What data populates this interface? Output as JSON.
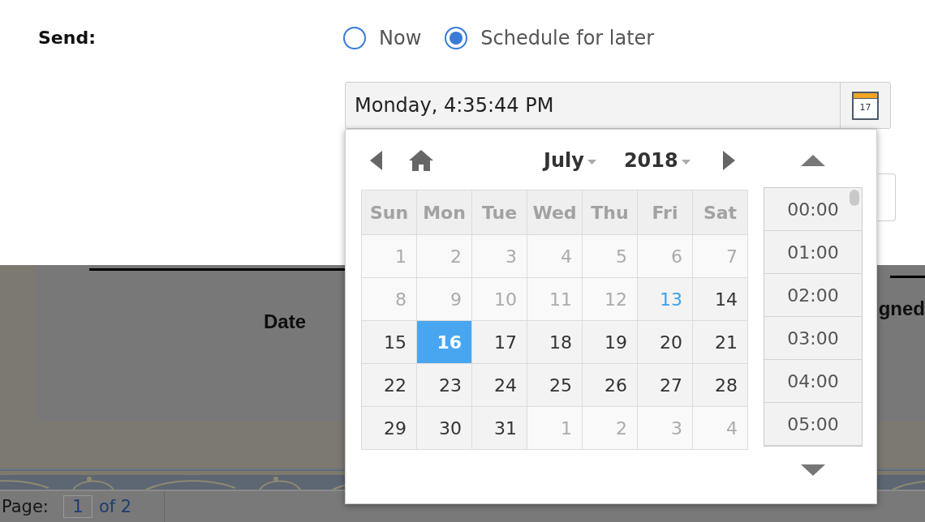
{
  "send": {
    "label": "Send:",
    "options": [
      {
        "label": "Now",
        "selected": false
      },
      {
        "label": "Schedule for later",
        "selected": true
      }
    ]
  },
  "schedule_field": {
    "value": "Monday, 4:35:44 PM",
    "calendar_icon_day": "17"
  },
  "date_picker": {
    "month": "July",
    "year": "2018",
    "weekdays": [
      "Sun",
      "Mon",
      "Tue",
      "Wed",
      "Thu",
      "Fri",
      "Sat"
    ],
    "weeks": [
      [
        {
          "day": "1",
          "muted": true,
          "today": false,
          "selected": false
        },
        {
          "day": "2",
          "muted": true,
          "today": false,
          "selected": false
        },
        {
          "day": "3",
          "muted": true,
          "today": false,
          "selected": false
        },
        {
          "day": "4",
          "muted": true,
          "today": false,
          "selected": false
        },
        {
          "day": "5",
          "muted": true,
          "today": false,
          "selected": false
        },
        {
          "day": "6",
          "muted": true,
          "today": false,
          "selected": false
        },
        {
          "day": "7",
          "muted": true,
          "today": false,
          "selected": false
        }
      ],
      [
        {
          "day": "8",
          "muted": true,
          "today": false,
          "selected": false
        },
        {
          "day": "9",
          "muted": true,
          "today": false,
          "selected": false
        },
        {
          "day": "10",
          "muted": true,
          "today": false,
          "selected": false
        },
        {
          "day": "11",
          "muted": true,
          "today": false,
          "selected": false
        },
        {
          "day": "12",
          "muted": true,
          "today": false,
          "selected": false
        },
        {
          "day": "13",
          "muted": false,
          "today": true,
          "selected": false
        },
        {
          "day": "14",
          "muted": false,
          "today": false,
          "selected": false
        }
      ],
      [
        {
          "day": "15",
          "muted": false,
          "today": false,
          "selected": false
        },
        {
          "day": "16",
          "muted": false,
          "today": false,
          "selected": true
        },
        {
          "day": "17",
          "muted": false,
          "today": false,
          "selected": false
        },
        {
          "day": "18",
          "muted": false,
          "today": false,
          "selected": false
        },
        {
          "day": "19",
          "muted": false,
          "today": false,
          "selected": false
        },
        {
          "day": "20",
          "muted": false,
          "today": false,
          "selected": false
        },
        {
          "day": "21",
          "muted": false,
          "today": false,
          "selected": false
        }
      ],
      [
        {
          "day": "22",
          "muted": false,
          "today": false,
          "selected": false
        },
        {
          "day": "23",
          "muted": false,
          "today": false,
          "selected": false
        },
        {
          "day": "24",
          "muted": false,
          "today": false,
          "selected": false
        },
        {
          "day": "25",
          "muted": false,
          "today": false,
          "selected": false
        },
        {
          "day": "26",
          "muted": false,
          "today": false,
          "selected": false
        },
        {
          "day": "27",
          "muted": false,
          "today": false,
          "selected": false
        },
        {
          "day": "28",
          "muted": false,
          "today": false,
          "selected": false
        }
      ],
      [
        {
          "day": "29",
          "muted": false,
          "today": false,
          "selected": false
        },
        {
          "day": "30",
          "muted": false,
          "today": false,
          "selected": false
        },
        {
          "day": "31",
          "muted": false,
          "today": false,
          "selected": false
        },
        {
          "day": "1",
          "muted": true,
          "today": false,
          "selected": false
        },
        {
          "day": "2",
          "muted": true,
          "today": false,
          "selected": false
        },
        {
          "day": "3",
          "muted": true,
          "today": false,
          "selected": false
        },
        {
          "day": "4",
          "muted": true,
          "today": false,
          "selected": false
        }
      ]
    ],
    "times": [
      {
        "label": "00:00",
        "selected": false
      },
      {
        "label": "01:00",
        "selected": false
      },
      {
        "label": "02:00",
        "selected": false
      },
      {
        "label": "03:00",
        "selected": false
      },
      {
        "label": "04:00",
        "selected": false
      },
      {
        "label": "05:00",
        "selected": false
      }
    ]
  },
  "background_page": {
    "column_headers": [
      "Date",
      "gned"
    ],
    "pager": {
      "label": "Page:",
      "page": "1",
      "total": "of 2"
    }
  }
}
